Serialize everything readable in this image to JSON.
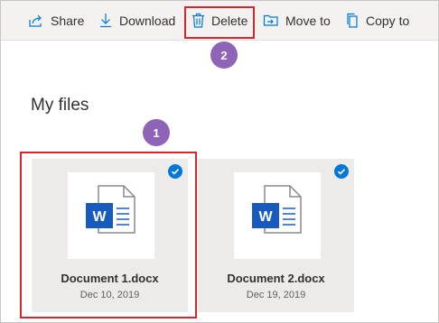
{
  "toolbar": {
    "items": [
      {
        "label": "Share",
        "icon": "share-icon"
      },
      {
        "label": "Download",
        "icon": "download-icon"
      },
      {
        "label": "Delete",
        "icon": "trash-icon"
      },
      {
        "label": "Move to",
        "icon": "move-to-icon"
      },
      {
        "label": "Copy to",
        "icon": "copy-icon"
      }
    ]
  },
  "annotations": {
    "step1": "1",
    "step2": "2",
    "highlight_color": "#d9262e",
    "badge_color": "#8f63b7"
  },
  "main": {
    "title": "My files",
    "files": [
      {
        "name": "Document 1.docx",
        "date": "Dec 10, 2019",
        "selected": true,
        "icon": "word-doc-icon"
      },
      {
        "name": "Document 2.docx",
        "date": "Dec 19, 2019",
        "selected": true,
        "icon": "word-doc-icon"
      }
    ]
  },
  "colors": {
    "word_blue": "#185abd",
    "check_blue": "#0078d4",
    "toolbar_bg": "#f3f2f1",
    "tile_bg": "#edebe9"
  }
}
